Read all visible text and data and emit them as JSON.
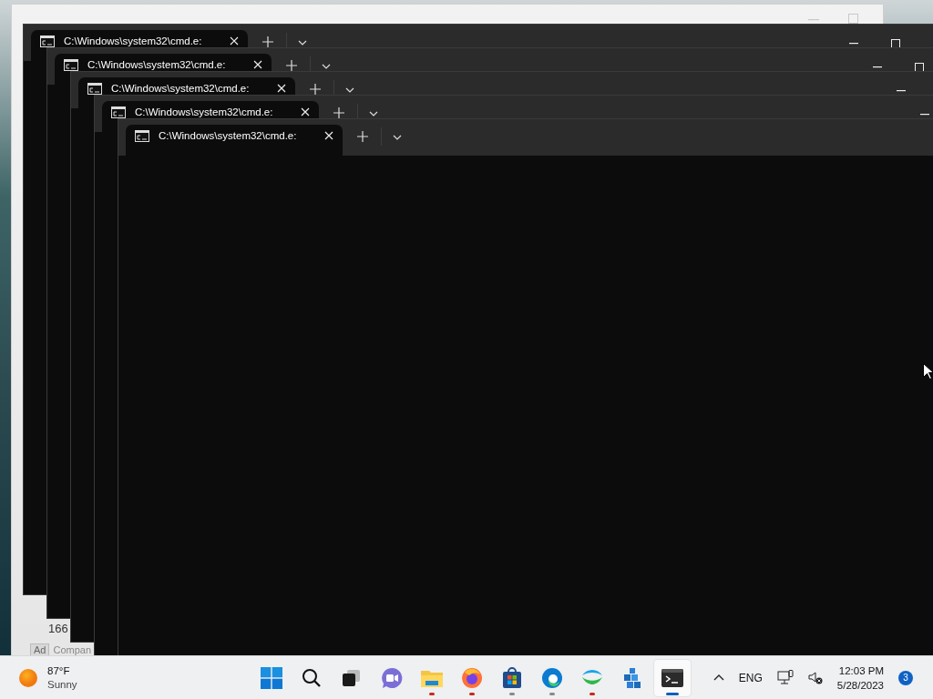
{
  "background_window": {
    "number": "166",
    "ad_badge": "Ad",
    "ad_text": "Compan"
  },
  "terminal_windows": [
    {
      "tab_title": "C:\\Windows\\system32\\cmd.e:"
    },
    {
      "tab_title": "C:\\Windows\\system32\\cmd.e:"
    },
    {
      "tab_title": "C:\\Windows\\system32\\cmd.e:"
    },
    {
      "tab_title": "C:\\Windows\\system32\\cmd.e:"
    },
    {
      "tab_title": "C:\\Windows\\system32\\cmd.e:"
    }
  ],
  "taskbar": {
    "weather": {
      "temperature": "87°F",
      "condition": "Sunny"
    },
    "apps": [
      {
        "kind": "start",
        "active": false
      },
      {
        "kind": "search",
        "active": false
      },
      {
        "kind": "task-view",
        "active": false
      },
      {
        "kind": "chat",
        "active": false
      },
      {
        "kind": "folder",
        "active": false,
        "color": "#c42b1c"
      },
      {
        "kind": "browser-fox",
        "active": false,
        "color": "#c42b1c"
      },
      {
        "kind": "store",
        "active": false,
        "color": "#8a8a8a"
      },
      {
        "kind": "browser-wave",
        "active": false,
        "color": "#8a8a8a"
      },
      {
        "kind": "cloud-app",
        "active": false,
        "color": "#c42b1c"
      },
      {
        "kind": "cubes",
        "active": false
      },
      {
        "kind": "terminal",
        "active": true,
        "color": "#005fb8"
      }
    ],
    "tray": {
      "language": "ENG",
      "time": "12:03 PM",
      "date": "5/28/2023",
      "notifications": "3"
    }
  }
}
